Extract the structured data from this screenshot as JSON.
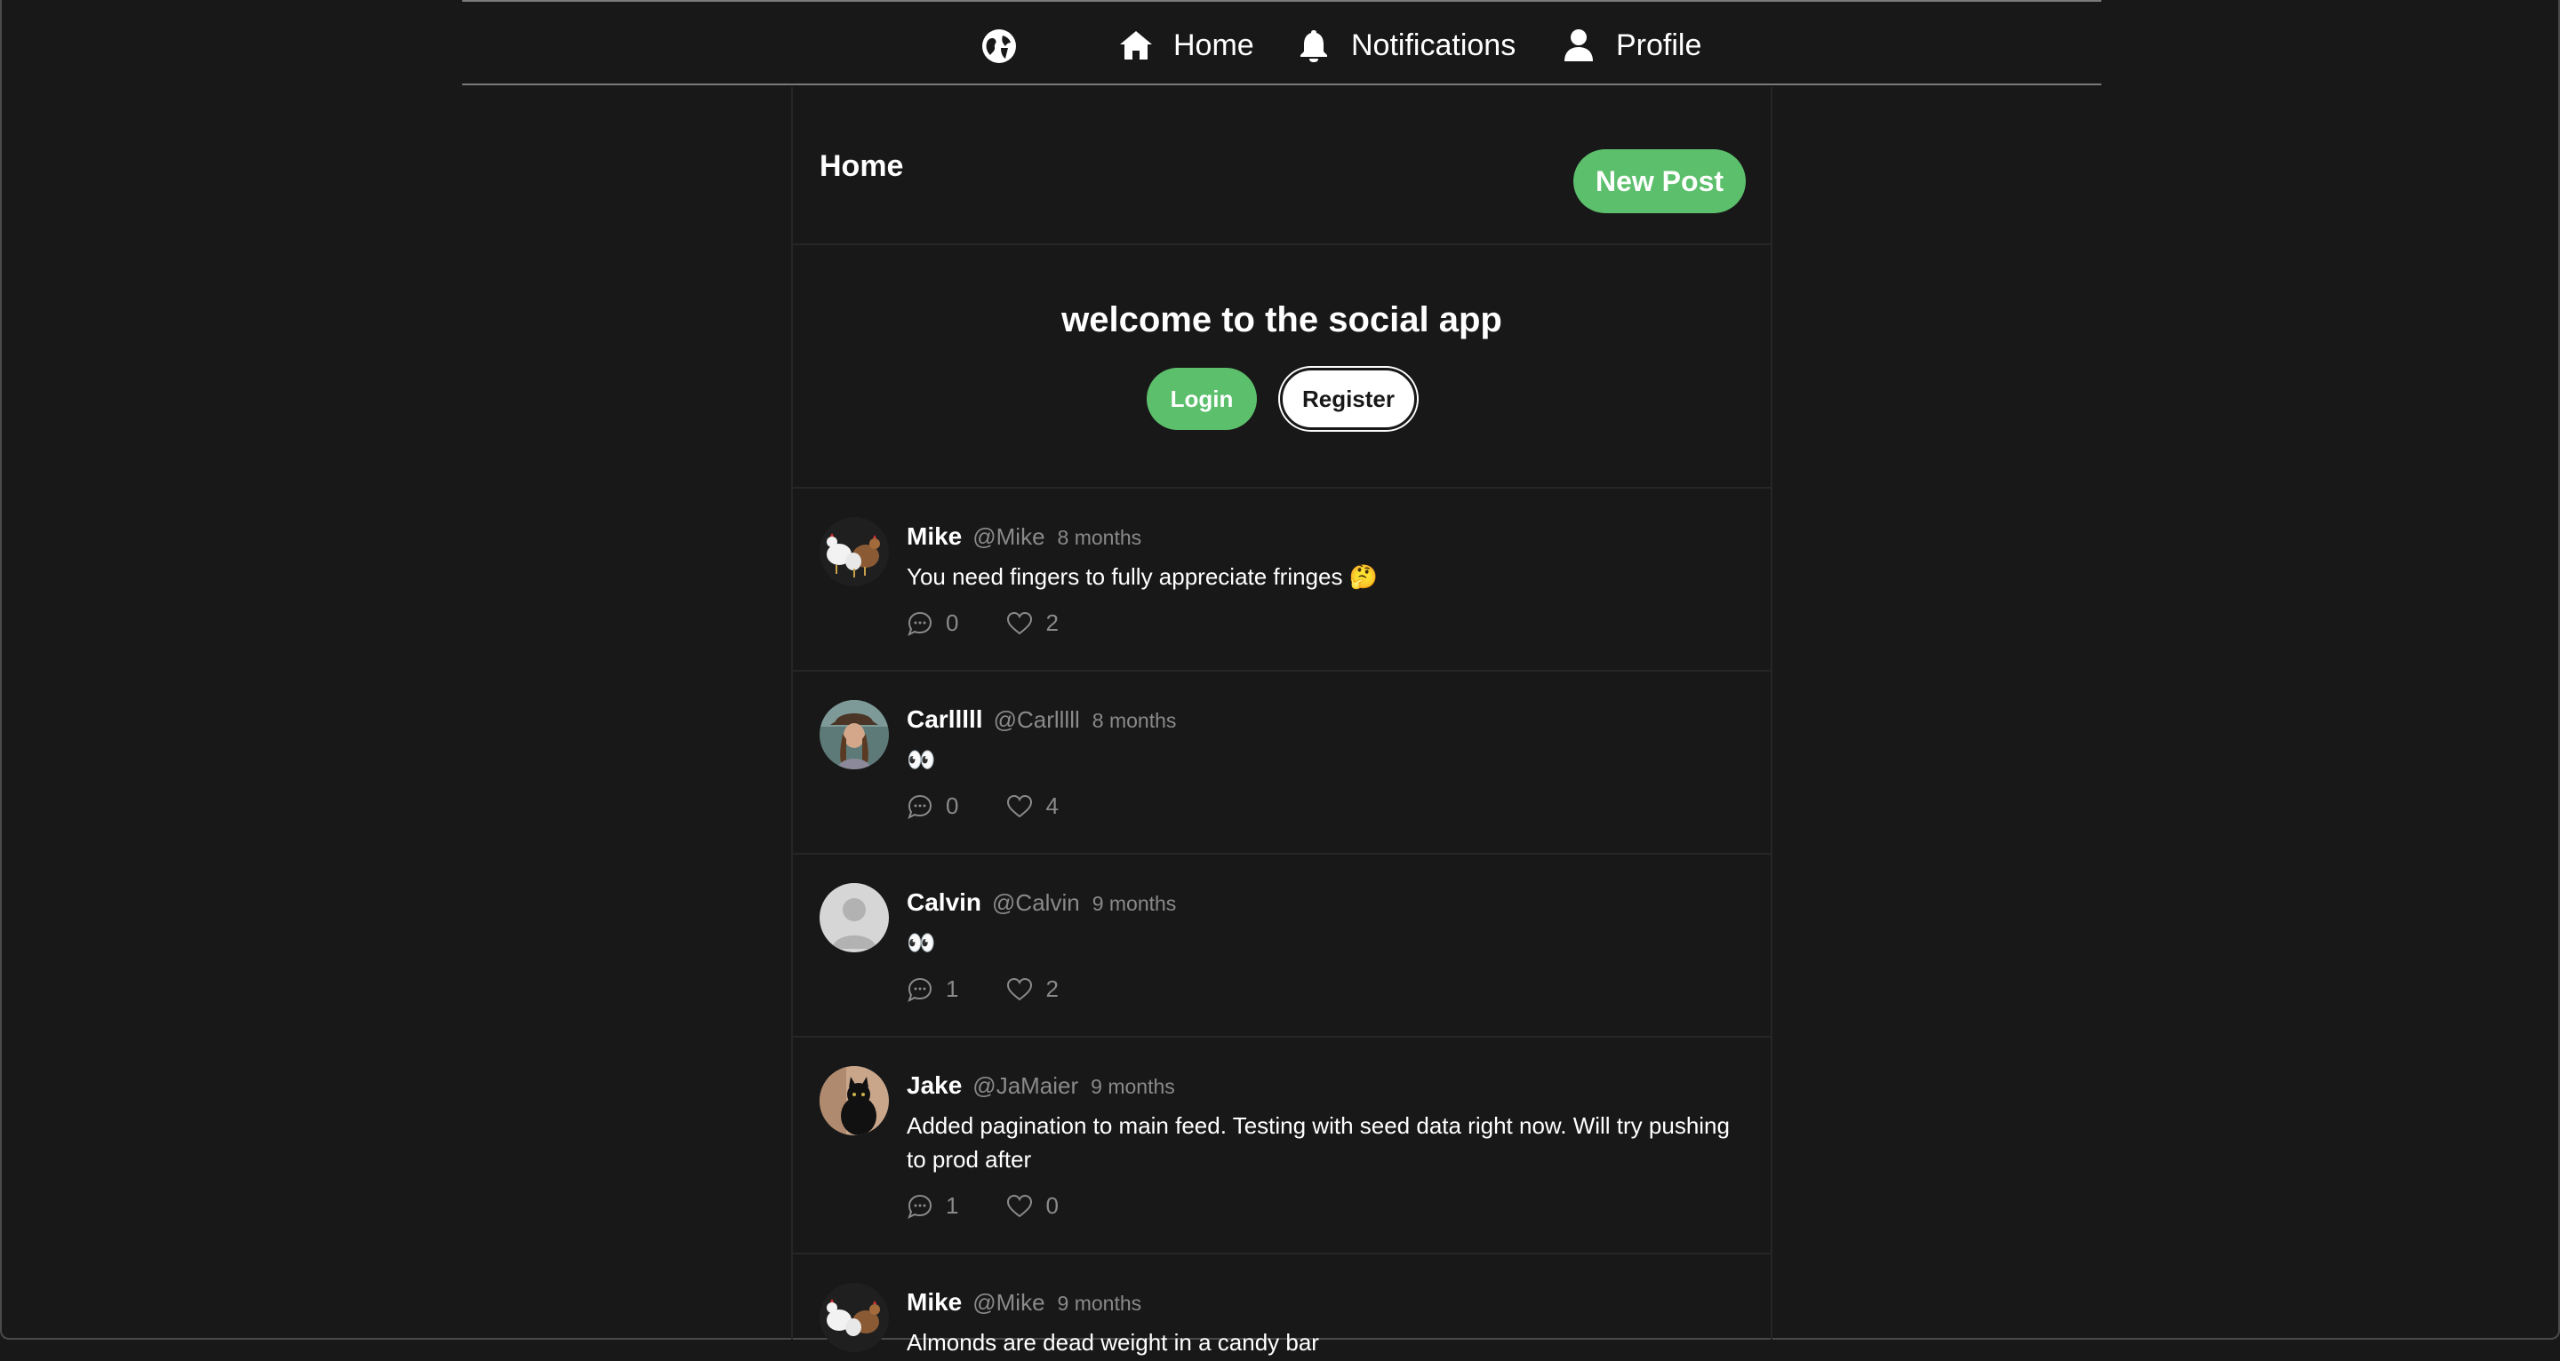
{
  "nav": {
    "items": [
      {
        "label": "Home",
        "icon": "home-icon"
      },
      {
        "label": "Notifications",
        "icon": "bell-icon"
      },
      {
        "label": "Profile",
        "icon": "user-icon"
      }
    ]
  },
  "header": {
    "title": "Home",
    "new_post_label": "New Post"
  },
  "welcome": {
    "title": "welcome to the social app",
    "login_label": "Login",
    "register_label": "Register"
  },
  "posts": [
    {
      "name": "Mike",
      "handle": "@Mike",
      "time": "8 months",
      "body": "You need fingers to fully appreciate fringes 🤔",
      "comments": "0",
      "likes": "2",
      "avatar": "chickens-avatar"
    },
    {
      "name": "Carlllll",
      "handle": "@Carlllll",
      "time": "8 months",
      "body": "👀",
      "comments": "0",
      "likes": "4",
      "avatar": "person-avatar"
    },
    {
      "name": "Calvin",
      "handle": "@Calvin",
      "time": "9 months",
      "body": "👀",
      "comments": "1",
      "likes": "2",
      "avatar": "default-avatar"
    },
    {
      "name": "Jake",
      "handle": "@JaMaier",
      "time": "9 months",
      "body": "Added pagination to main feed. Testing with seed data right now. Will try pushing to prod after",
      "comments": "1",
      "likes": "0",
      "avatar": "cat-avatar"
    },
    {
      "name": "Mike",
      "handle": "@Mike",
      "time": "9 months",
      "body": "Almonds are dead weight in a candy bar",
      "comments": "",
      "likes": "",
      "avatar": "chickens-avatar"
    }
  ],
  "colors": {
    "background": "#181818",
    "accent": "#5cbf6c",
    "muted": "#8a8a8a"
  }
}
